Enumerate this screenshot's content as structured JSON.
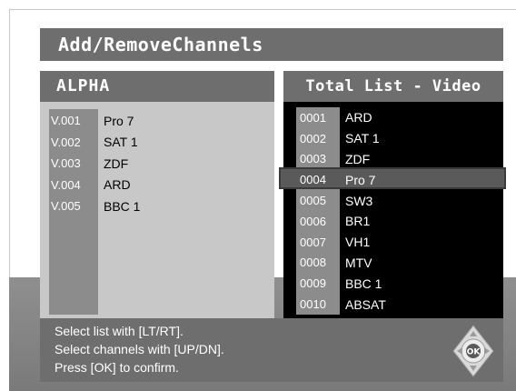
{
  "title": "Add/RemoveChannels",
  "left_panel": {
    "header": "ALPHA",
    "items": [
      {
        "number": "V.001",
        "name": "Pro 7"
      },
      {
        "number": "V.002",
        "name": "SAT 1"
      },
      {
        "number": "V.003",
        "name": "ZDF"
      },
      {
        "number": "V.004",
        "name": "ARD"
      },
      {
        "number": "V.005",
        "name": "BBC 1"
      }
    ]
  },
  "right_panel": {
    "header": "Total List - Video",
    "selected_index": 3,
    "items": [
      {
        "number": "0001",
        "name": "ARD"
      },
      {
        "number": "0002",
        "name": "SAT 1"
      },
      {
        "number": "0003",
        "name": "ZDF"
      },
      {
        "number": "0004",
        "name": "Pro 7"
      },
      {
        "number": "0005",
        "name": "SW3"
      },
      {
        "number": "0006",
        "name": "BR1"
      },
      {
        "number": "0007",
        "name": "VH1"
      },
      {
        "number": "0008",
        "name": "MTV"
      },
      {
        "number": "0009",
        "name": "BBC 1"
      },
      {
        "number": "0010",
        "name": "ABSAT"
      }
    ]
  },
  "footer": {
    "lines": [
      "Select list with [LT/RT].",
      "Select channels with  [UP/DN].",
      "Press [OK] to confirm."
    ],
    "nav_pad": {
      "icon": "remote-navigation-pad-icon",
      "ok_label": "OK"
    }
  },
  "colors": {
    "panel_gray": "#6e6e6e",
    "left_body": "#c8c8c8",
    "number_column": "#8c8c8c",
    "right_body": "#000000",
    "text_light": "#ffffff"
  }
}
